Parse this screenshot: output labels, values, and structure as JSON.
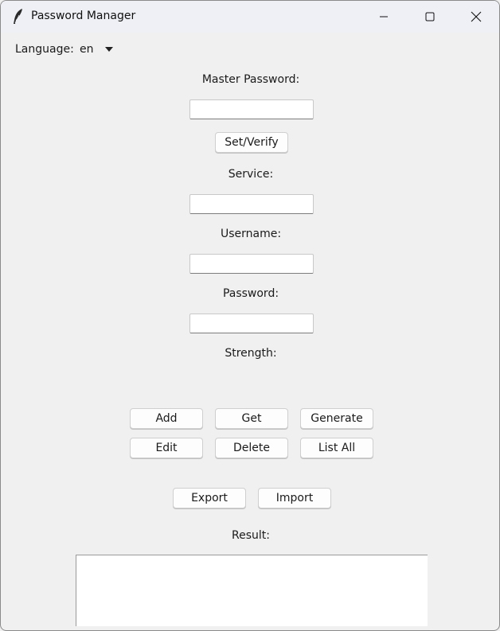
{
  "window": {
    "title": "Password Manager",
    "controls": {
      "minimize": "minimize-icon",
      "maximize": "maximize-icon",
      "close": "close-icon"
    }
  },
  "language": {
    "label": "Language:",
    "value": "en"
  },
  "master_password": {
    "label": "Master Password:",
    "value": "",
    "button": "Set/Verify"
  },
  "service": {
    "label": "Service:",
    "value": ""
  },
  "username": {
    "label": "Username:",
    "value": ""
  },
  "password": {
    "label": "Password:",
    "value": ""
  },
  "strength": {
    "label": "Strength:",
    "value": ""
  },
  "actions": {
    "add": "Add",
    "get": "Get",
    "generate": "Generate",
    "edit": "Edit",
    "delete": "Delete",
    "list_all": "List All",
    "export": "Export",
    "import": "Import"
  },
  "result": {
    "label": "Result:",
    "value": ""
  },
  "colors": {
    "window_bg": "#f0f0f0",
    "titlebar_bg": "#eef0f6",
    "entry_bg": "#ffffff"
  }
}
